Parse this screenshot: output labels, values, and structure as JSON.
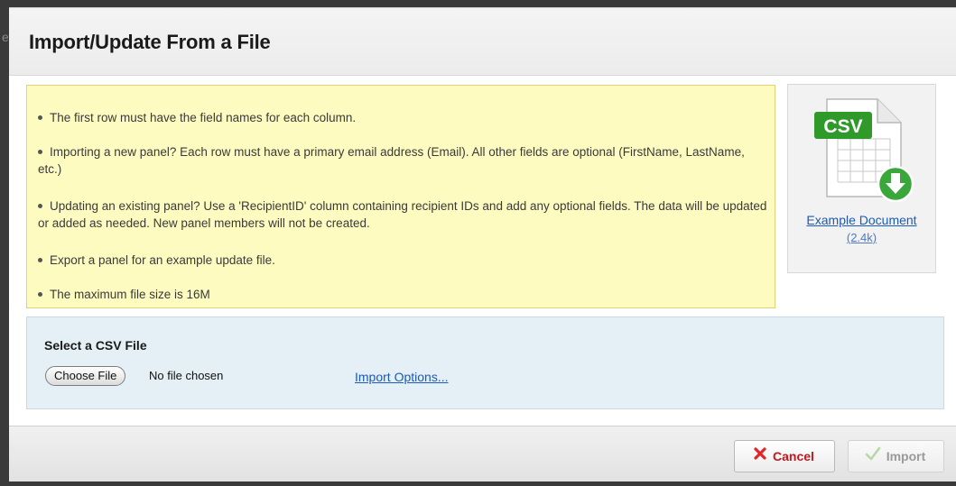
{
  "background_fragment": "e",
  "dialog": {
    "title": "Import/Update From a File"
  },
  "instructions": [
    "The first row must have the field names for each column.",
    "Importing a new panel? Each row must have a primary email address (Email). All other fields are optional (FirstName, LastName, etc.)",
    "Updating an existing panel? Use a 'RecipientID' column containing recipient IDs and add any optional fields. The data will be updated or added as needed. New panel members will not be created.",
    "Export a panel for an example update file.",
    "The maximum file size is 16M"
  ],
  "example": {
    "badge": "CSV",
    "link_label": "Example Document",
    "size": "(2.4k)",
    "icon": "csv-document-download-icon"
  },
  "file_select": {
    "label": "Select a CSV File",
    "choose_button": "Choose File",
    "status": "No file chosen",
    "options_link": "Import Options..."
  },
  "footer": {
    "cancel_label": "Cancel",
    "import_label": "Import",
    "cancel_icon": "x-icon",
    "import_icon": "checkmark-icon",
    "cancel_color": "#c4161c",
    "import_disabled": true
  }
}
